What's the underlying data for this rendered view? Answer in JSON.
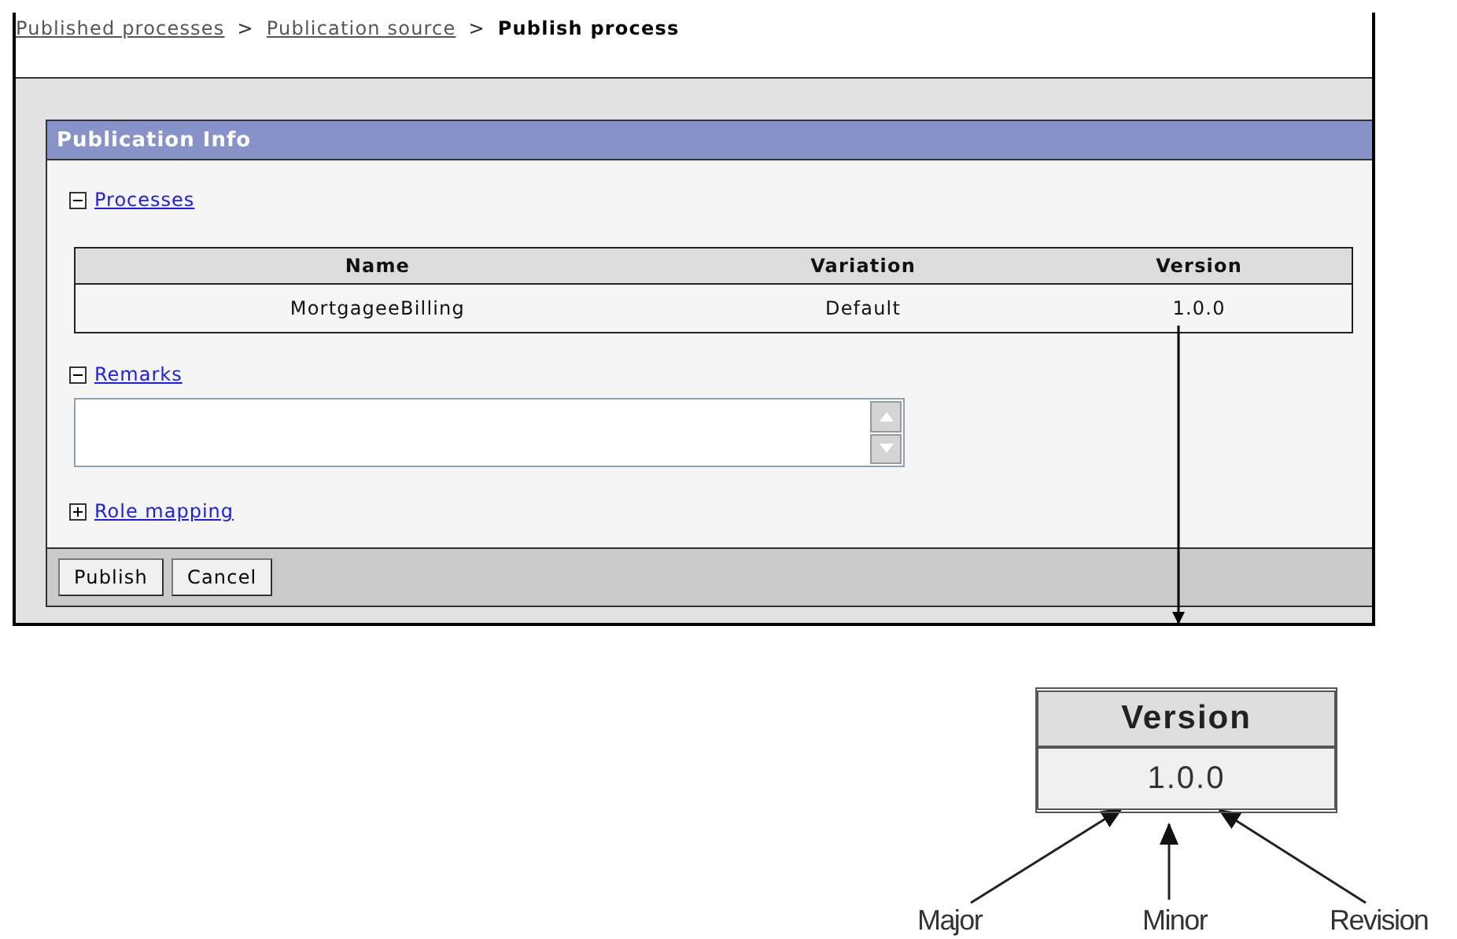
{
  "breadcrumb": [
    {
      "label": "Published processes",
      "kind": "link"
    },
    {
      "label": ">",
      "kind": "separator"
    },
    {
      "label": "Publication source",
      "kind": "link"
    },
    {
      "label": ">",
      "kind": "separator"
    },
    {
      "label": "Publish process",
      "kind": "current"
    }
  ],
  "panel": {
    "title": "Publication Info",
    "sections": [
      {
        "label": "Processes",
        "expanded": true,
        "kind": "table",
        "columns": [
          "Name",
          "Variation",
          "Version"
        ],
        "rows": [
          [
            "MortgageeBilling",
            "Default",
            "1.0.0"
          ]
        ]
      },
      {
        "label": "Remarks",
        "expanded": true,
        "kind": "textarea"
      },
      {
        "label": "Role mapping",
        "expanded": false,
        "kind": "none"
      }
    ],
    "buttons": [
      "Publish",
      "Cancel"
    ]
  },
  "callout": {
    "header": "Version",
    "value": "1.0.0",
    "parts": [
      "Major",
      "Minor",
      "Revision"
    ]
  }
}
